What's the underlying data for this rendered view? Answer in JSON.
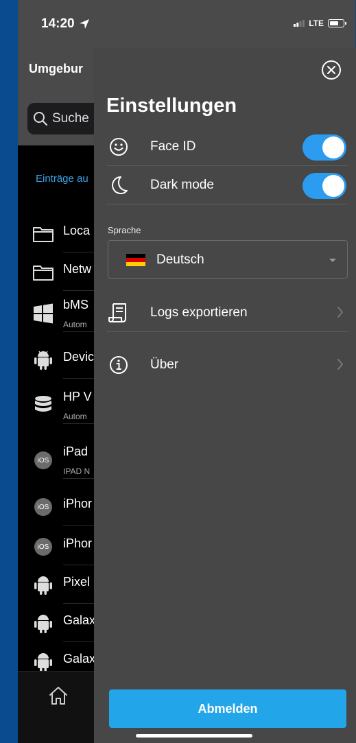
{
  "status_bar": {
    "time": "14:20",
    "network": "LTE"
  },
  "background": {
    "title": "Umgebur",
    "search_placeholder": "Suche",
    "link": "Einträge au",
    "items": [
      {
        "icon": "folder-icon",
        "title": "Loca",
        "subtitle": ""
      },
      {
        "icon": "folder-icon",
        "title": "Netw",
        "subtitle": ""
      },
      {
        "icon": "windows-icon",
        "title": "bMS",
        "subtitle": "Autom"
      },
      {
        "icon": "android-icon",
        "title": "Devic",
        "subtitle": ""
      },
      {
        "icon": "database-icon",
        "title": "HP V",
        "subtitle": "Autom"
      },
      {
        "icon": "ios-badge",
        "title": "iPad",
        "subtitle": "IPAD N"
      },
      {
        "icon": "ios-badge",
        "title": "iPhor",
        "subtitle": ""
      },
      {
        "icon": "ios-badge",
        "title": "iPhor",
        "subtitle": ""
      },
      {
        "icon": "android-icon",
        "title": "Pixel",
        "subtitle": ""
      },
      {
        "icon": "android-icon",
        "title": "Galax",
        "subtitle": ""
      },
      {
        "icon": "android-icon",
        "title": "Galax",
        "subtitle": ""
      }
    ],
    "ios_badge_text": "iOS"
  },
  "settings": {
    "title": "Einstellungen",
    "face_id": {
      "label": "Face ID",
      "enabled": true
    },
    "dark_mode": {
      "label": "Dark mode",
      "enabled": true
    },
    "language_label": "Sprache",
    "language_value": "Deutsch",
    "logs_label": "Logs exportieren",
    "about_label": "Über",
    "logout_label": "Abmelden"
  },
  "colors": {
    "accent": "#2b9cf0",
    "button": "#23a5ea",
    "panel": "#474747"
  }
}
